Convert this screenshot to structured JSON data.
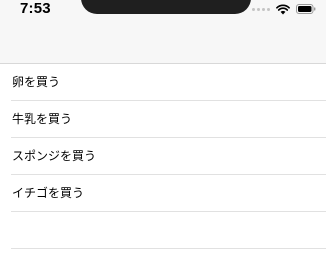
{
  "status_bar": {
    "time": "7:53"
  },
  "list": {
    "items": [
      {
        "label": "卵を買う"
      },
      {
        "label": "牛乳を買う"
      },
      {
        "label": "スポンジを買う"
      },
      {
        "label": "イチゴを買う"
      },
      {
        "label": ""
      }
    ]
  },
  "colors": {
    "nav_background": "#f7f7f7",
    "separator": "#e1e1e1",
    "notch": "#1f1f1f"
  }
}
